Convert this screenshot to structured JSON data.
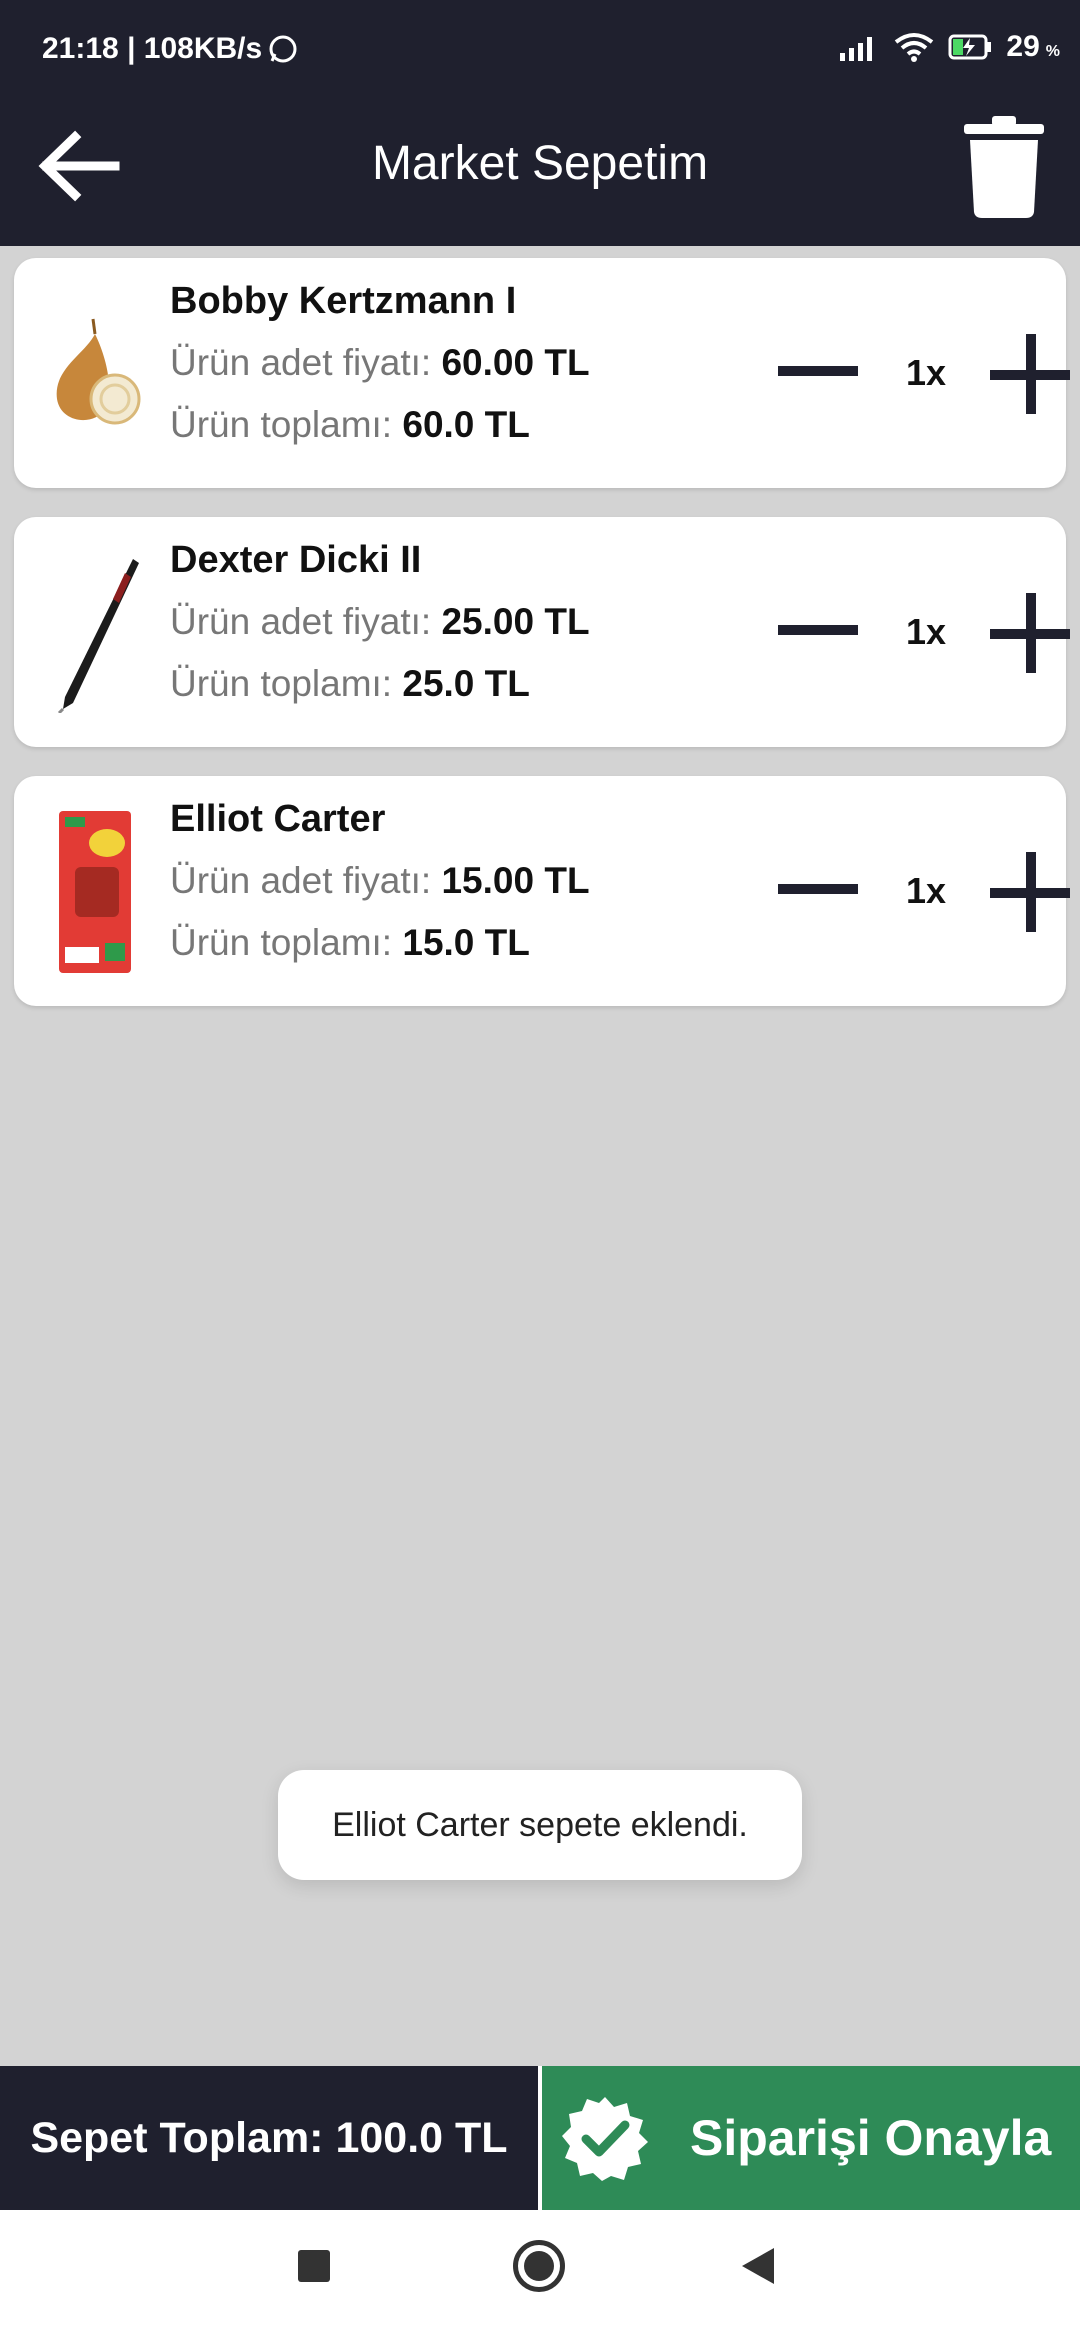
{
  "status": {
    "time_speed": "21:18 | 108KB/s",
    "battery": "29",
    "battery_unit": "%",
    "icons": [
      "whatsapp-icon",
      "signal-icon",
      "wifi-icon",
      "battery-charging-icon"
    ]
  },
  "appbar": {
    "title": "Market Sepetim",
    "back_icon": "arrow-left-icon",
    "trash_icon": "trash-icon"
  },
  "items": [
    {
      "name": "Bobby Kertzmann I",
      "price_label": "Ürün adet fiyatı: ",
      "price": "60.00 TL",
      "total_label": "Ürün toplamı: ",
      "total": "60.0 TL",
      "qty": "1x",
      "image": "onion-image"
    },
    {
      "name": "Dexter Dicki II",
      "price_label": "Ürün adet fiyatı: ",
      "price": "25.00 TL",
      "total_label": "Ürün toplamı: ",
      "total": "25.0 TL",
      "qty": "1x",
      "image": "pen-image"
    },
    {
      "name": "Elliot Carter",
      "price_label": "Ürün adet fiyatı: ",
      "price": "15.00 TL",
      "total_label": "Ürün toplamı: ",
      "total": "15.0 TL",
      "qty": "1x",
      "image": "snack-package-image"
    }
  ],
  "toast": "Elliot Carter sepete eklendi.",
  "footer": {
    "total": "Sepet Toplam: 100.0 TL",
    "confirm": "Siparişi Onayla",
    "confirm_icon": "verified-badge-icon"
  },
  "colors": {
    "dark": "#1f202e",
    "green": "#2e8b57",
    "background": "#d3d3d3"
  }
}
